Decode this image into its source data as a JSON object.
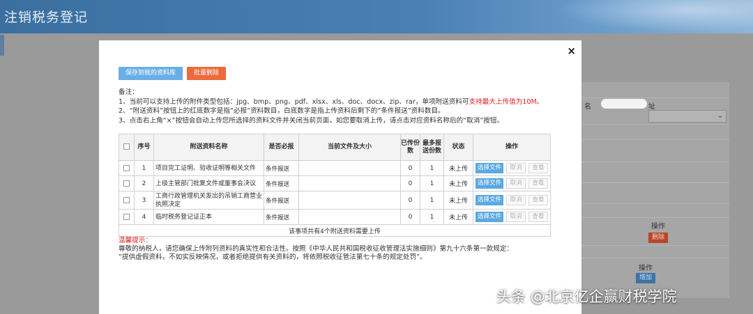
{
  "header": {
    "title": "注销税务登记"
  },
  "background": {
    "partial_label": "名",
    "partial_label_right": "址",
    "col_op_1": "操作",
    "delete_label": "删除",
    "col_op_2": "操作",
    "add_label": "增加"
  },
  "modal": {
    "close_label": "×",
    "save_button": "保存到我的资料库",
    "batch_delete_button": "批量删除",
    "notes": {
      "heading": "备注：",
      "line1_prefix": "1、当前可以支持上传的附件类型包括：jpg、bmp、png、pdf、xlsx、xls、doc、docx、zip、rar，单项附送资料可",
      "line1_red": "支持最大上传值为10M。",
      "line2": "2、“附送资料”按钮上的红底数字是指“必报”资料数目，白底数字是指上传资料后剩下的“条件报送”资料数目。",
      "line3": "3、点击右上角“×”按钮会自动上传您所选择的资料文件并关闭当前页面，如您要取消上传，请点击对应资料名称后的“取消”按钮。"
    },
    "table": {
      "headers": {
        "seq": "序号",
        "name": "附送资料名称",
        "required": "是否必报",
        "file": "当前文件及大小",
        "uploaded": "已传份数",
        "max": "最多报送份数",
        "status": "状态",
        "ops": "操作"
      },
      "rows": [
        {
          "seq": "1",
          "name": "项目完工证明、验收证明等相关文件",
          "required": "条件报送",
          "file": "",
          "uploaded": "0",
          "max": "1",
          "status": "未上传",
          "choose": "选择文件",
          "cancel": "取消",
          "view": "查看"
        },
        {
          "seq": "2",
          "name": "上级主管部门批复文件或董事会决议",
          "required": "条件报送",
          "file": "",
          "uploaded": "0",
          "max": "1",
          "status": "未上传",
          "choose": "选择文件",
          "cancel": "取消",
          "view": "查看"
        },
        {
          "seq": "3",
          "name": "工商行政管理机关发出的吊销工商营业执照决定",
          "required": "条件报送",
          "file": "",
          "uploaded": "0",
          "max": "1",
          "status": "未上传",
          "choose": "选择文件",
          "cancel": "取消",
          "view": "查看"
        },
        {
          "seq": "4",
          "name": "临时税务登记证正本",
          "required": "条件报送",
          "file": "",
          "uploaded": "0",
          "max": "1",
          "status": "未上传",
          "choose": "选择文件",
          "cancel": "取消",
          "view": "查看"
        }
      ],
      "footer": "该事项共有4个附送资料需要上传"
    },
    "tips": {
      "title": "温馨提示：",
      "line1": "尊敬的纳税人，请您确保上传附列资料的真实性和合法性。按照《中华人民共和国税收征收管理法实施细则》第九十六条第一款规定：",
      "line2": "“提供虚假资料，不如实反映情况，或者拒绝提供有关资料的，将依照税收征管法第七十条的规定处罚”。"
    }
  },
  "watermark": "头条 @北京亿企赢财税学院",
  "colors": {
    "save_button": "#6aaee6",
    "batch_delete_button": "#ec6a3c",
    "warning_red": "#e02020",
    "header_bg": "#4a7fb3"
  }
}
